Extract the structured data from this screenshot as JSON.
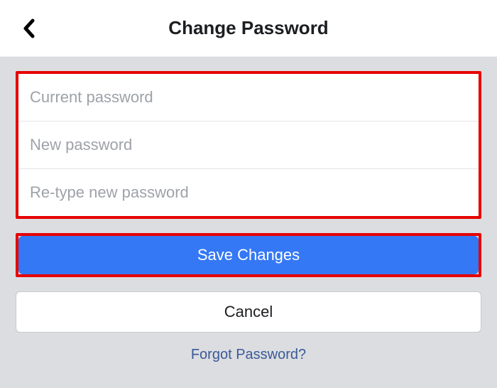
{
  "header": {
    "title": "Change Password"
  },
  "form": {
    "current_placeholder": "Current password",
    "new_placeholder": "New password",
    "retype_placeholder": "Re-type new password",
    "save_label": "Save Changes",
    "cancel_label": "Cancel",
    "forgot_label": "Forgot Password?"
  },
  "colors": {
    "highlight_border": "#e60000",
    "primary_button": "#3578f5",
    "link_text": "#3a5998",
    "content_bg": "#dcdde0"
  }
}
